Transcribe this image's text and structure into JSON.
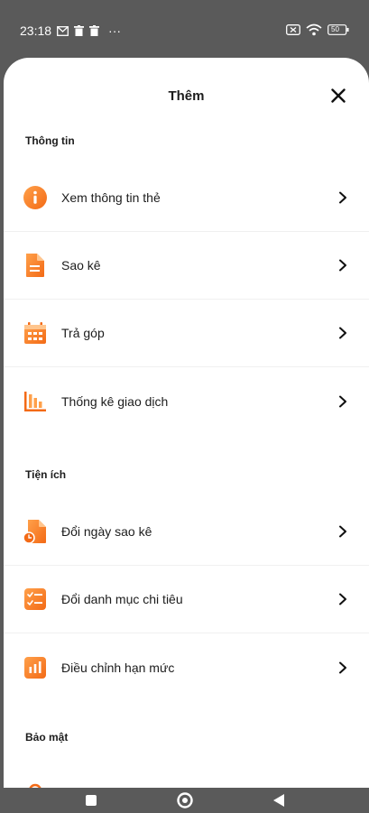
{
  "status_bar": {
    "time": "23:18",
    "more": "···",
    "battery": "50"
  },
  "header": {
    "title": "Thêm"
  },
  "sections": [
    {
      "title": "Thông tin",
      "items": [
        {
          "label": "Xem thông tin thẻ",
          "icon": "info-icon"
        },
        {
          "label": "Sao kê",
          "icon": "document-icon"
        },
        {
          "label": "Trả góp",
          "icon": "calendar-icon"
        },
        {
          "label": "Thống kê giao dịch",
          "icon": "bar-chart-icon"
        }
      ]
    },
    {
      "title": "Tiện ích",
      "items": [
        {
          "label": "Đổi ngày sao kê",
          "icon": "document-clock-icon"
        },
        {
          "label": "Đổi danh mục chi tiêu",
          "icon": "checklist-icon"
        },
        {
          "label": "Điều chỉnh hạn mức",
          "icon": "bar-chart-icon"
        }
      ]
    },
    {
      "title": "Bảo mật",
      "items": [
        {
          "label": "",
          "icon": "lock-icon"
        }
      ]
    }
  ],
  "colors": {
    "accent": "#f7761f",
    "accent_light": "#ffa04a",
    "status_bg": "#5a5a5a",
    "text": "#1c1c1c"
  }
}
